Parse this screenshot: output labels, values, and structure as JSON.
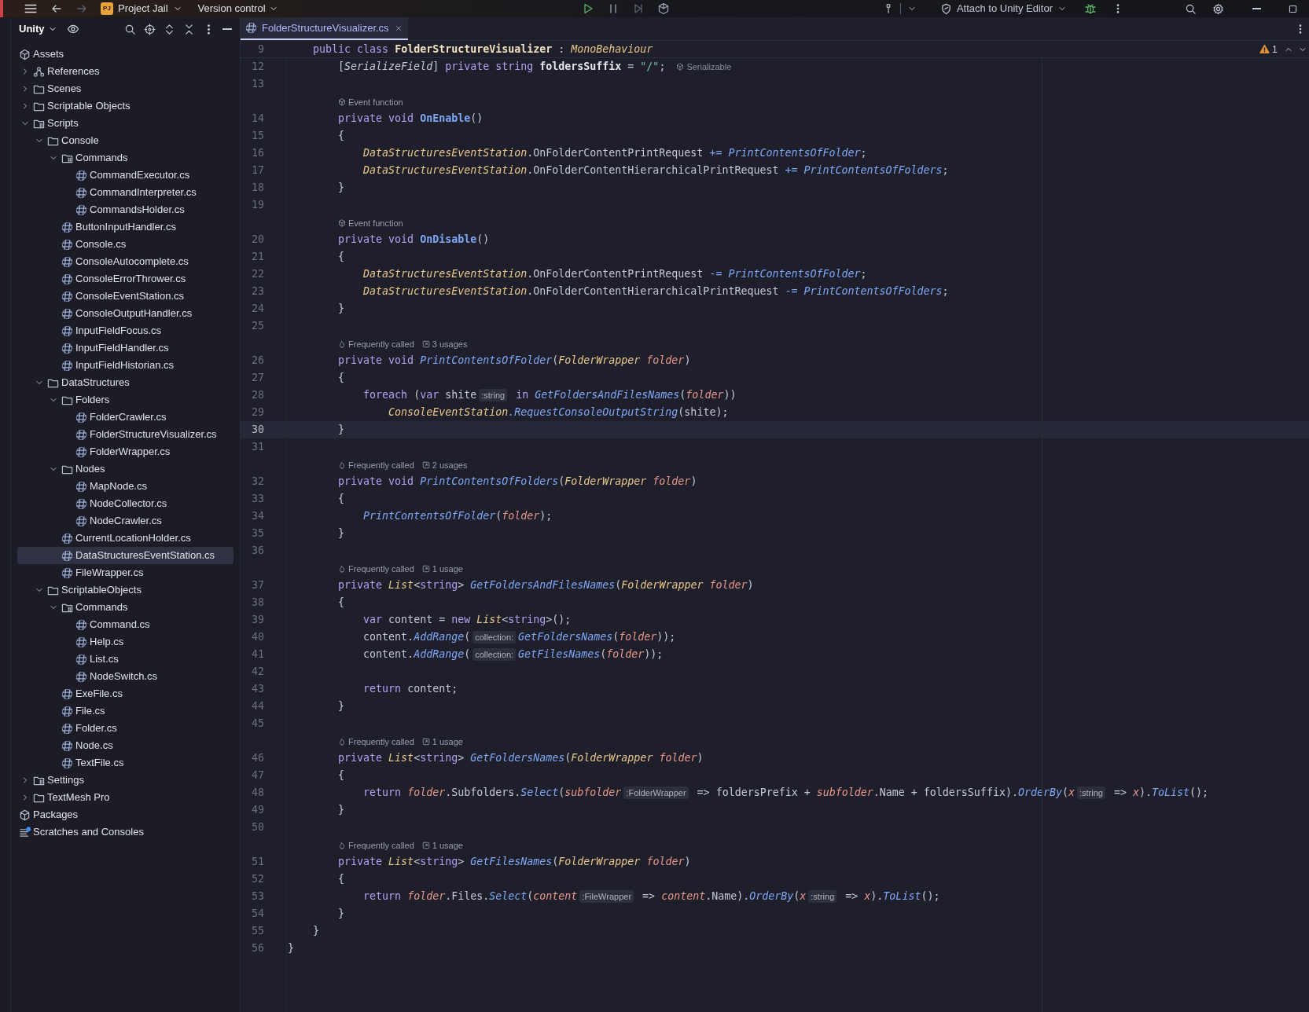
{
  "top_bar": {
    "project_badge": "PJ",
    "project": "Project Jail",
    "vcs": "Version control",
    "run_config": "Attach to Unity Editor"
  },
  "sidebar": {
    "title": "Unity",
    "tree": [
      {
        "label": "Assets",
        "kind": "root",
        "children": [
          {
            "label": "References",
            "kind": "references",
            "expanded": false,
            "selected": false
          },
          {
            "label": "Scenes",
            "kind": "folder",
            "expanded": false,
            "selected": false
          },
          {
            "label": "Scriptable Objects",
            "kind": "folder",
            "expanded": false,
            "selected": false
          },
          {
            "label": "Scripts",
            "kind": "special-folder",
            "expanded": true,
            "selected": false,
            "children": [
              {
                "label": "Console",
                "kind": "folder",
                "expanded": true,
                "selected": false,
                "children": [
                  {
                    "label": "Commands",
                    "kind": "special-folder",
                    "expanded": true,
                    "selected": false,
                    "children": [
                      {
                        "label": "CommandExecutor.cs",
                        "kind": "file",
                        "selected": false
                      },
                      {
                        "label": "CommandInterpreter.cs",
                        "kind": "file",
                        "selected": false
                      },
                      {
                        "label": "CommandsHolder.cs",
                        "kind": "file",
                        "selected": false
                      }
                    ]
                  },
                  {
                    "label": "ButtonInputHandler.cs",
                    "kind": "file",
                    "selected": false
                  },
                  {
                    "label": "Console.cs",
                    "kind": "file",
                    "selected": false
                  },
                  {
                    "label": "ConsoleAutocomplete.cs",
                    "kind": "file",
                    "selected": false
                  },
                  {
                    "label": "ConsoleErrorThrower.cs",
                    "kind": "file",
                    "selected": false
                  },
                  {
                    "label": "ConsoleEventStation.cs",
                    "kind": "file",
                    "selected": false
                  },
                  {
                    "label": "ConsoleOutputHandler.cs",
                    "kind": "file",
                    "selected": false
                  },
                  {
                    "label": "InputFieldFocus.cs",
                    "kind": "file",
                    "selected": false
                  },
                  {
                    "label": "InputFieldHandler.cs",
                    "kind": "file",
                    "selected": false
                  },
                  {
                    "label": "InputFieldHistorian.cs",
                    "kind": "file",
                    "selected": false
                  }
                ]
              },
              {
                "label": "DataStructures",
                "kind": "folder",
                "expanded": true,
                "selected": false,
                "children": [
                  {
                    "label": "Folders",
                    "kind": "folder",
                    "expanded": true,
                    "selected": false,
                    "children": [
                      {
                        "label": "FolderCrawler.cs",
                        "kind": "file",
                        "selected": false
                      },
                      {
                        "label": "FolderStructureVisualizer.cs",
                        "kind": "file",
                        "selected": false
                      },
                      {
                        "label": "FolderWrapper.cs",
                        "kind": "file",
                        "selected": false
                      }
                    ]
                  },
                  {
                    "label": "Nodes",
                    "kind": "folder",
                    "expanded": true,
                    "selected": false,
                    "children": [
                      {
                        "label": "MapNode.cs",
                        "kind": "file",
                        "selected": false
                      },
                      {
                        "label": "NodeCollector.cs",
                        "kind": "file",
                        "selected": false
                      },
                      {
                        "label": "NodeCrawler.cs",
                        "kind": "file",
                        "selected": false
                      }
                    ]
                  },
                  {
                    "label": "CurrentLocationHolder.cs",
                    "kind": "file",
                    "selected": false
                  },
                  {
                    "label": "DataStructuresEventStation.cs",
                    "kind": "file",
                    "selected": true
                  },
                  {
                    "label": "FileWrapper.cs",
                    "kind": "file",
                    "selected": false
                  }
                ]
              },
              {
                "label": "ScriptableObjects",
                "kind": "folder",
                "expanded": true,
                "selected": false,
                "children": [
                  {
                    "label": "Commands",
                    "kind": "special-folder",
                    "expanded": true,
                    "selected": false,
                    "children": [
                      {
                        "label": "Command.cs",
                        "kind": "file",
                        "selected": false
                      },
                      {
                        "label": "Help.cs",
                        "kind": "file",
                        "selected": false
                      },
                      {
                        "label": "List.cs",
                        "kind": "file",
                        "selected": false
                      },
                      {
                        "label": "NodeSwitch.cs",
                        "kind": "file",
                        "selected": false
                      }
                    ]
                  },
                  {
                    "label": "ExeFile.cs",
                    "kind": "file",
                    "selected": false
                  },
                  {
                    "label": "File.cs",
                    "kind": "file",
                    "selected": false
                  },
                  {
                    "label": "Folder.cs",
                    "kind": "file",
                    "selected": false
                  },
                  {
                    "label": "Node.cs",
                    "kind": "file",
                    "selected": false
                  },
                  {
                    "label": "TextFile.cs",
                    "kind": "file",
                    "selected": false
                  }
                ]
              }
            ]
          },
          {
            "label": "Settings",
            "kind": "special-folder",
            "expanded": false,
            "selected": false
          },
          {
            "label": "TextMesh Pro",
            "kind": "folder",
            "expanded": false,
            "selected": false
          }
        ]
      },
      {
        "label": "Packages",
        "kind": "packages"
      },
      {
        "label": "Scratches and Consoles",
        "kind": "scratches"
      }
    ]
  },
  "editor": {
    "tabs": [
      {
        "label": "FolderStructureVisualizer.cs",
        "selected": true
      }
    ],
    "warnings": "1",
    "sticky": {
      "number": "9",
      "tokens": [
        {
          "text": "    public ",
          "kind": "keyword"
        },
        {
          "text": "class ",
          "kind": "keyword"
        },
        {
          "text": "FolderStructureVisualizer",
          "kind": "class"
        },
        {
          "text": " : ",
          "kind": "plain"
        },
        {
          "text": "MonoBehaviour",
          "kind": "type"
        }
      ]
    },
    "rows": [
      {
        "kind": "code",
        "number": "12",
        "current": false,
        "tokens": [
          {
            "text": "        [",
            "kind": "plain"
          },
          {
            "text": "SerializeField",
            "kind": "attr"
          },
          {
            "text": "] ",
            "kind": "plain"
          },
          {
            "text": "private ",
            "kind": "keyword"
          },
          {
            "text": "string ",
            "kind": "keyword"
          },
          {
            "text": "foldersSuffix",
            "kind": "field"
          },
          {
            "text": " = ",
            "kind": "plain"
          },
          {
            "text": "\"/\"",
            "kind": "string"
          },
          {
            "text": ";",
            "kind": "plain"
          },
          {
            "text": "Serializable",
            "kind": "badge"
          }
        ]
      },
      {
        "kind": "code",
        "number": "13",
        "current": false,
        "tokens": []
      },
      {
        "kind": "lens",
        "items": [
          {
            "kind": "event",
            "text": "Event function"
          }
        ]
      },
      {
        "kind": "code",
        "number": "14",
        "current": false,
        "tokens": [
          {
            "text": "        private ",
            "kind": "keyword"
          },
          {
            "text": "void ",
            "kind": "keyword"
          },
          {
            "text": "OnEnable",
            "kind": "decl"
          },
          {
            "text": "()",
            "kind": "plain"
          }
        ]
      },
      {
        "kind": "code",
        "number": "15",
        "current": false,
        "tokens": [
          {
            "text": "        {",
            "kind": "plain"
          }
        ]
      },
      {
        "kind": "code",
        "number": "16",
        "current": false,
        "tokens": [
          {
            "text": "            DataStructuresEventStation",
            "kind": "type"
          },
          {
            "text": ".OnFolderContentPrintRequest",
            "kind": "plain"
          },
          {
            "text": " += ",
            "kind": "op"
          },
          {
            "text": "PrintContentsOfFolder",
            "kind": "method"
          },
          {
            "text": ";",
            "kind": "plain"
          }
        ]
      },
      {
        "kind": "code",
        "number": "17",
        "current": false,
        "tokens": [
          {
            "text": "            DataStructuresEventStation",
            "kind": "type"
          },
          {
            "text": ".OnFolderContentHierarchicalPrintRequest",
            "kind": "plain"
          },
          {
            "text": " += ",
            "kind": "op"
          },
          {
            "text": "PrintContentsOfFolders",
            "kind": "method"
          },
          {
            "text": ";",
            "kind": "plain"
          }
        ]
      },
      {
        "kind": "code",
        "number": "18",
        "current": false,
        "tokens": [
          {
            "text": "        }",
            "kind": "plain"
          }
        ]
      },
      {
        "kind": "code",
        "number": "19",
        "current": false,
        "tokens": []
      },
      {
        "kind": "lens",
        "items": [
          {
            "kind": "event",
            "text": "Event function"
          }
        ]
      },
      {
        "kind": "code",
        "number": "20",
        "current": false,
        "tokens": [
          {
            "text": "        private ",
            "kind": "keyword"
          },
          {
            "text": "void ",
            "kind": "keyword"
          },
          {
            "text": "OnDisable",
            "kind": "decl"
          },
          {
            "text": "()",
            "kind": "plain"
          }
        ]
      },
      {
        "kind": "code",
        "number": "21",
        "current": false,
        "tokens": [
          {
            "text": "        {",
            "kind": "plain"
          }
        ]
      },
      {
        "kind": "code",
        "number": "22",
        "current": false,
        "tokens": [
          {
            "text": "            DataStructuresEventStation",
            "kind": "type"
          },
          {
            "text": ".OnFolderContentPrintRequest",
            "kind": "plain"
          },
          {
            "text": " -= ",
            "kind": "op"
          },
          {
            "text": "PrintContentsOfFolder",
            "kind": "method"
          },
          {
            "text": ";",
            "kind": "plain"
          }
        ]
      },
      {
        "kind": "code",
        "number": "23",
        "current": false,
        "tokens": [
          {
            "text": "            DataStructuresEventStation",
            "kind": "type"
          },
          {
            "text": ".OnFolderContentHierarchicalPrintRequest",
            "kind": "plain"
          },
          {
            "text": " -= ",
            "kind": "op"
          },
          {
            "text": "PrintContentsOfFolders",
            "kind": "method"
          },
          {
            "text": ";",
            "kind": "plain"
          }
        ]
      },
      {
        "kind": "code",
        "number": "24",
        "current": false,
        "tokens": [
          {
            "text": "        }",
            "kind": "plain"
          }
        ]
      },
      {
        "kind": "code",
        "number": "25",
        "current": false,
        "tokens": []
      },
      {
        "kind": "lens",
        "items": [
          {
            "kind": "hot",
            "text": "Frequently called"
          },
          {
            "kind": "usages",
            "text": "3 usages"
          }
        ]
      },
      {
        "kind": "code",
        "number": "26",
        "current": false,
        "tokens": [
          {
            "text": "        private ",
            "kind": "keyword"
          },
          {
            "text": "void ",
            "kind": "keyword"
          },
          {
            "text": "PrintContentsOfFolder",
            "kind": "method"
          },
          {
            "text": "(",
            "kind": "plain"
          },
          {
            "text": "FolderWrapper ",
            "kind": "type"
          },
          {
            "text": "folder",
            "kind": "param"
          },
          {
            "text": ")",
            "kind": "plain"
          }
        ]
      },
      {
        "kind": "code",
        "number": "27",
        "current": false,
        "tokens": [
          {
            "text": "        {",
            "kind": "plain"
          }
        ]
      },
      {
        "kind": "code",
        "number": "28",
        "current": false,
        "tokens": [
          {
            "text": "            foreach ",
            "kind": "keyword"
          },
          {
            "text": "(",
            "kind": "plain"
          },
          {
            "text": "var ",
            "kind": "keyword"
          },
          {
            "text": "shite",
            "kind": "plain"
          },
          {
            "text": ":string",
            "kind": "hint"
          },
          {
            "text": " in ",
            "kind": "keyword"
          },
          {
            "text": "GetFoldersAndFilesNames",
            "kind": "method"
          },
          {
            "text": "(",
            "kind": "plain"
          },
          {
            "text": "folder",
            "kind": "param"
          },
          {
            "text": "))",
            "kind": "plain"
          }
        ]
      },
      {
        "kind": "code",
        "number": "29",
        "current": false,
        "tokens": [
          {
            "text": "                ConsoleEventStation",
            "kind": "type"
          },
          {
            "text": ".RequestConsoleOutputString",
            "kind": "method"
          },
          {
            "text": "(shite);",
            "kind": "plain"
          }
        ]
      },
      {
        "kind": "code",
        "number": "30",
        "current": true,
        "tokens": [
          {
            "text": "        }",
            "kind": "plain"
          }
        ]
      },
      {
        "kind": "code",
        "number": "31",
        "current": false,
        "tokens": []
      },
      {
        "kind": "lens",
        "items": [
          {
            "kind": "hot",
            "text": "Frequently called"
          },
          {
            "kind": "usages",
            "text": "2 usages"
          }
        ]
      },
      {
        "kind": "code",
        "number": "32",
        "current": false,
        "tokens": [
          {
            "text": "        private ",
            "kind": "keyword"
          },
          {
            "text": "void ",
            "kind": "keyword"
          },
          {
            "text": "PrintContentsOfFolders",
            "kind": "method"
          },
          {
            "text": "(",
            "kind": "plain"
          },
          {
            "text": "FolderWrapper ",
            "kind": "type"
          },
          {
            "text": "folder",
            "kind": "param"
          },
          {
            "text": ")",
            "kind": "plain"
          }
        ]
      },
      {
        "kind": "code",
        "number": "33",
        "current": false,
        "tokens": [
          {
            "text": "        {",
            "kind": "plain"
          }
        ]
      },
      {
        "kind": "code",
        "number": "34",
        "current": false,
        "tokens": [
          {
            "text": "            PrintContentsOfFolder",
            "kind": "method"
          },
          {
            "text": "(",
            "kind": "plain"
          },
          {
            "text": "folder",
            "kind": "param"
          },
          {
            "text": ");",
            "kind": "plain"
          }
        ]
      },
      {
        "kind": "code",
        "number": "35",
        "current": false,
        "tokens": [
          {
            "text": "        }",
            "kind": "plain"
          }
        ]
      },
      {
        "kind": "code",
        "number": "36",
        "current": false,
        "tokens": []
      },
      {
        "kind": "lens",
        "items": [
          {
            "kind": "hot",
            "text": "Frequently called"
          },
          {
            "kind": "usages",
            "text": "1 usage"
          }
        ]
      },
      {
        "kind": "code",
        "number": "37",
        "current": false,
        "tokens": [
          {
            "text": "        private ",
            "kind": "keyword"
          },
          {
            "text": "List",
            "kind": "type"
          },
          {
            "text": "<",
            "kind": "plain"
          },
          {
            "text": "string",
            "kind": "keyword"
          },
          {
            "text": "> ",
            "kind": "plain"
          },
          {
            "text": "GetFoldersAndFilesNames",
            "kind": "method"
          },
          {
            "text": "(",
            "kind": "plain"
          },
          {
            "text": "FolderWrapper ",
            "kind": "type"
          },
          {
            "text": "folder",
            "kind": "param"
          },
          {
            "text": ")",
            "kind": "plain"
          }
        ]
      },
      {
        "kind": "code",
        "number": "38",
        "current": false,
        "tokens": [
          {
            "text": "        {",
            "kind": "plain"
          }
        ]
      },
      {
        "kind": "code",
        "number": "39",
        "current": false,
        "tokens": [
          {
            "text": "            var ",
            "kind": "keyword"
          },
          {
            "text": "content = ",
            "kind": "plain"
          },
          {
            "text": "new ",
            "kind": "keyword"
          },
          {
            "text": "List",
            "kind": "type"
          },
          {
            "text": "<",
            "kind": "plain"
          },
          {
            "text": "string",
            "kind": "keyword"
          },
          {
            "text": ">();",
            "kind": "plain"
          }
        ]
      },
      {
        "kind": "code",
        "number": "40",
        "current": false,
        "tokens": [
          {
            "text": "            content.",
            "kind": "plain"
          },
          {
            "text": "AddRange",
            "kind": "method"
          },
          {
            "text": "(",
            "kind": "plain"
          },
          {
            "text": "collection:",
            "kind": "hint"
          },
          {
            "text": "GetFoldersNames",
            "kind": "method"
          },
          {
            "text": "(",
            "kind": "plain"
          },
          {
            "text": "folder",
            "kind": "param"
          },
          {
            "text": "));",
            "kind": "plain"
          }
        ]
      },
      {
        "kind": "code",
        "number": "41",
        "current": false,
        "tokens": [
          {
            "text": "            content.",
            "kind": "plain"
          },
          {
            "text": "AddRange",
            "kind": "method"
          },
          {
            "text": "(",
            "kind": "plain"
          },
          {
            "text": "collection:",
            "kind": "hint"
          },
          {
            "text": "GetFilesNames",
            "kind": "method"
          },
          {
            "text": "(",
            "kind": "plain"
          },
          {
            "text": "folder",
            "kind": "param"
          },
          {
            "text": "));",
            "kind": "plain"
          }
        ]
      },
      {
        "kind": "code",
        "number": "42",
        "current": false,
        "tokens": []
      },
      {
        "kind": "code",
        "number": "43",
        "current": false,
        "tokens": [
          {
            "text": "            return ",
            "kind": "keyword"
          },
          {
            "text": "content;",
            "kind": "plain"
          }
        ]
      },
      {
        "kind": "code",
        "number": "44",
        "current": false,
        "tokens": [
          {
            "text": "        }",
            "kind": "plain"
          }
        ]
      },
      {
        "kind": "code",
        "number": "45",
        "current": false,
        "tokens": []
      },
      {
        "kind": "lens",
        "items": [
          {
            "kind": "hot",
            "text": "Frequently called"
          },
          {
            "kind": "usages",
            "text": "1 usage"
          }
        ]
      },
      {
        "kind": "code",
        "number": "46",
        "current": false,
        "tokens": [
          {
            "text": "        private ",
            "kind": "keyword"
          },
          {
            "text": "List",
            "kind": "type"
          },
          {
            "text": "<",
            "kind": "plain"
          },
          {
            "text": "string",
            "kind": "keyword"
          },
          {
            "text": "> ",
            "kind": "plain"
          },
          {
            "text": "GetFoldersNames",
            "kind": "method"
          },
          {
            "text": "(",
            "kind": "plain"
          },
          {
            "text": "FolderWrapper ",
            "kind": "type"
          },
          {
            "text": "folder",
            "kind": "param"
          },
          {
            "text": ")",
            "kind": "plain"
          }
        ]
      },
      {
        "kind": "code",
        "number": "47",
        "current": false,
        "tokens": [
          {
            "text": "        {",
            "kind": "plain"
          }
        ]
      },
      {
        "kind": "code",
        "number": "48",
        "current": false,
        "tokens": [
          {
            "text": "            return ",
            "kind": "keyword"
          },
          {
            "text": "folder",
            "kind": "param"
          },
          {
            "text": ".Subfolders.",
            "kind": "plain"
          },
          {
            "text": "Select",
            "kind": "method"
          },
          {
            "text": "(",
            "kind": "plain"
          },
          {
            "text": "subfolder",
            "kind": "param"
          },
          {
            "text": ":FolderWrapper",
            "kind": "hint"
          },
          {
            "text": " => foldersPrefix + ",
            "kind": "plain"
          },
          {
            "text": "subfolder",
            "kind": "param"
          },
          {
            "text": ".Name + foldersSuffix).",
            "kind": "plain"
          },
          {
            "text": "OrderBy",
            "kind": "method"
          },
          {
            "text": "(",
            "kind": "plain"
          },
          {
            "text": "x",
            "kind": "param"
          },
          {
            "text": ":string",
            "kind": "hint"
          },
          {
            "text": " => ",
            "kind": "plain"
          },
          {
            "text": "x",
            "kind": "param"
          },
          {
            "text": ").",
            "kind": "plain"
          },
          {
            "text": "ToList",
            "kind": "method"
          },
          {
            "text": "();",
            "kind": "plain"
          }
        ]
      },
      {
        "kind": "code",
        "number": "49",
        "current": false,
        "tokens": [
          {
            "text": "        }",
            "kind": "plain"
          }
        ]
      },
      {
        "kind": "code",
        "number": "50",
        "current": false,
        "tokens": []
      },
      {
        "kind": "lens",
        "items": [
          {
            "kind": "hot",
            "text": "Frequently called"
          },
          {
            "kind": "usages",
            "text": "1 usage"
          }
        ]
      },
      {
        "kind": "code",
        "number": "51",
        "current": false,
        "tokens": [
          {
            "text": "        private ",
            "kind": "keyword"
          },
          {
            "text": "List",
            "kind": "type"
          },
          {
            "text": "<",
            "kind": "plain"
          },
          {
            "text": "string",
            "kind": "keyword"
          },
          {
            "text": "> ",
            "kind": "plain"
          },
          {
            "text": "GetFilesNames",
            "kind": "method"
          },
          {
            "text": "(",
            "kind": "plain"
          },
          {
            "text": "FolderWrapper ",
            "kind": "type"
          },
          {
            "text": "folder",
            "kind": "param"
          },
          {
            "text": ")",
            "kind": "plain"
          }
        ]
      },
      {
        "kind": "code",
        "number": "52",
        "current": false,
        "tokens": [
          {
            "text": "        {",
            "kind": "plain"
          }
        ]
      },
      {
        "kind": "code",
        "number": "53",
        "current": false,
        "tokens": [
          {
            "text": "            return ",
            "kind": "keyword"
          },
          {
            "text": "folder",
            "kind": "param"
          },
          {
            "text": ".Files.",
            "kind": "plain"
          },
          {
            "text": "Select",
            "kind": "method"
          },
          {
            "text": "(",
            "kind": "plain"
          },
          {
            "text": "content",
            "kind": "param"
          },
          {
            "text": ":FileWrapper",
            "kind": "hint"
          },
          {
            "text": " => ",
            "kind": "plain"
          },
          {
            "text": "content",
            "kind": "param"
          },
          {
            "text": ".Name).",
            "kind": "plain"
          },
          {
            "text": "OrderBy",
            "kind": "method"
          },
          {
            "text": "(",
            "kind": "plain"
          },
          {
            "text": "x",
            "kind": "param"
          },
          {
            "text": ":string",
            "kind": "hint"
          },
          {
            "text": " => ",
            "kind": "plain"
          },
          {
            "text": "x",
            "kind": "param"
          },
          {
            "text": ").",
            "kind": "plain"
          },
          {
            "text": "ToList",
            "kind": "method"
          },
          {
            "text": "();",
            "kind": "plain"
          }
        ]
      },
      {
        "kind": "code",
        "number": "54",
        "current": false,
        "tokens": [
          {
            "text": "        }",
            "kind": "plain"
          }
        ]
      },
      {
        "kind": "code",
        "number": "55",
        "current": false,
        "tokens": [
          {
            "text": "    }",
            "kind": "plain"
          }
        ]
      },
      {
        "kind": "code",
        "number": "56",
        "current": false,
        "tokens": [
          {
            "text": "}",
            "kind": "plain"
          }
        ]
      }
    ]
  }
}
